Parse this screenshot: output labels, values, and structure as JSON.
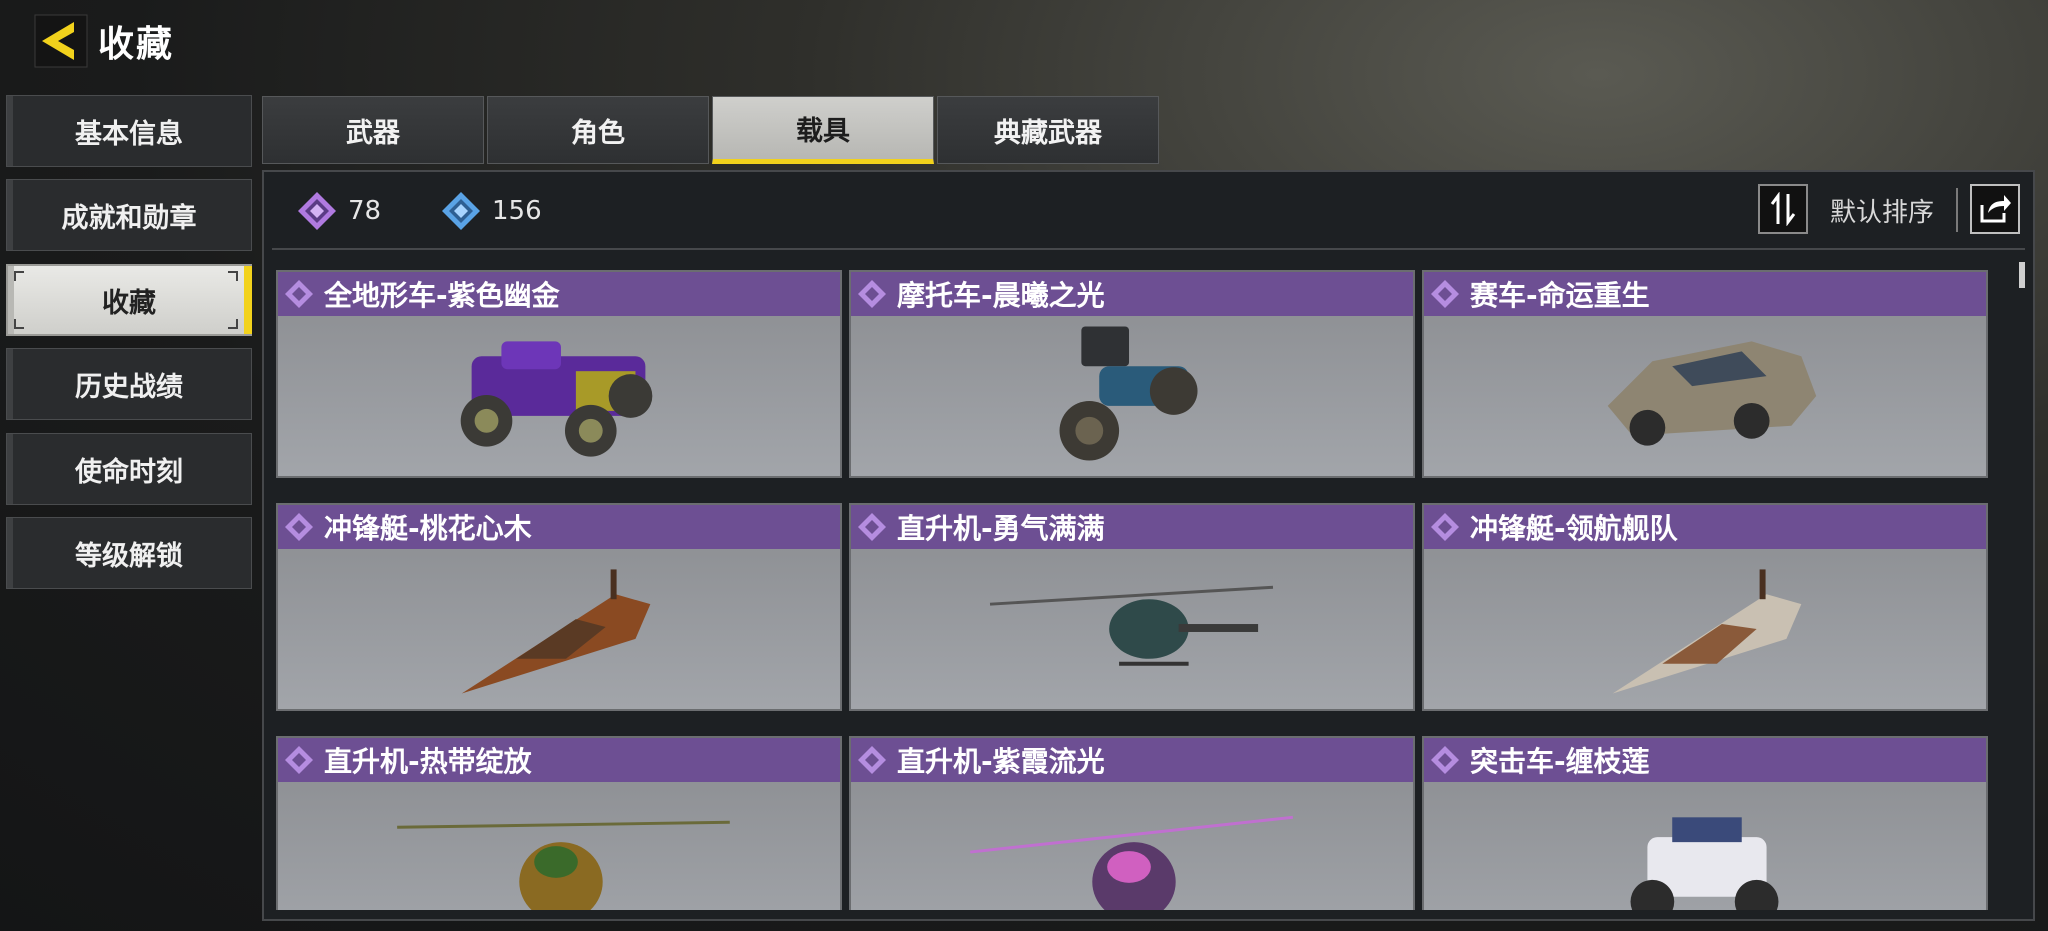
{
  "header": {
    "title": "收藏",
    "back_icon": "back-arrow-icon"
  },
  "sidebar": {
    "items": [
      {
        "label": "基本信息",
        "active": false
      },
      {
        "label": "成就和勋章",
        "active": false
      },
      {
        "label": "收藏",
        "active": true
      },
      {
        "label": "历史战绩",
        "active": false
      },
      {
        "label": "使命时刻",
        "active": false
      },
      {
        "label": "等级解锁",
        "active": false
      }
    ]
  },
  "tabs": [
    {
      "label": "武器",
      "active": false
    },
    {
      "label": "角色",
      "active": false
    },
    {
      "label": "载具",
      "active": true
    },
    {
      "label": "典藏武器",
      "active": false
    }
  ],
  "stats": {
    "purple": {
      "icon": "purple-diamond-icon",
      "value": "78"
    },
    "blue": {
      "icon": "blue-diamond-icon",
      "value": "156"
    }
  },
  "toolbar": {
    "sort_icon": "sort-arrows-icon",
    "sort_label": "默认排序",
    "share_icon": "share-icon"
  },
  "colors": {
    "accent": "#f2d21c",
    "card_header": "#6d4f93",
    "epic_purple": "#b07ae0",
    "rare_blue": "#5aa3e6"
  },
  "items": [
    {
      "name": "全地形车-紫色幽金",
      "kind": "atv"
    },
    {
      "name": "摩托车-晨曦之光",
      "kind": "motorcycle"
    },
    {
      "name": "赛车-命运重生",
      "kind": "race-car"
    },
    {
      "name": "冲锋艇-桃花心木",
      "kind": "boat"
    },
    {
      "name": "直升机-勇气满满",
      "kind": "helicopter"
    },
    {
      "name": "冲锋艇-领航舰队",
      "kind": "boat"
    },
    {
      "name": "直升机-热带绽放",
      "kind": "helicopter"
    },
    {
      "name": "直升机-紫霞流光",
      "kind": "helicopter"
    },
    {
      "name": "突击车-缠枝莲",
      "kind": "buggy"
    }
  ]
}
